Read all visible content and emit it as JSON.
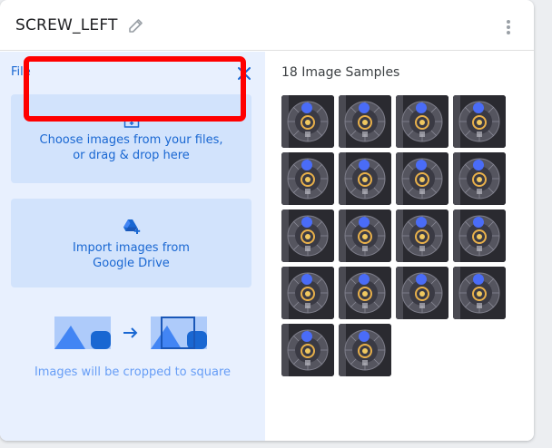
{
  "header": {
    "class_name": "SCREW_LEFT",
    "edit_icon": "pencil-icon",
    "more_icon": "more-vert-icon"
  },
  "upload_panel": {
    "section_label": "File",
    "close_icon": "close-icon",
    "upload_option": {
      "icon": "folder-add-icon",
      "line1": "Choose images from your files,",
      "line2": "or drag & drop here"
    },
    "drive_option": {
      "icon": "google-drive-add-icon",
      "line1": "Import images from",
      "line2": "Google Drive"
    },
    "crop_note": "Images will be cropped to square"
  },
  "samples": {
    "title": "18 Image Samples",
    "count": 18
  },
  "colors": {
    "accent": "#1967d2",
    "panel_bg": "#e8f0fe",
    "option_bg": "#d2e3fc",
    "highlight": "#ff0000"
  }
}
